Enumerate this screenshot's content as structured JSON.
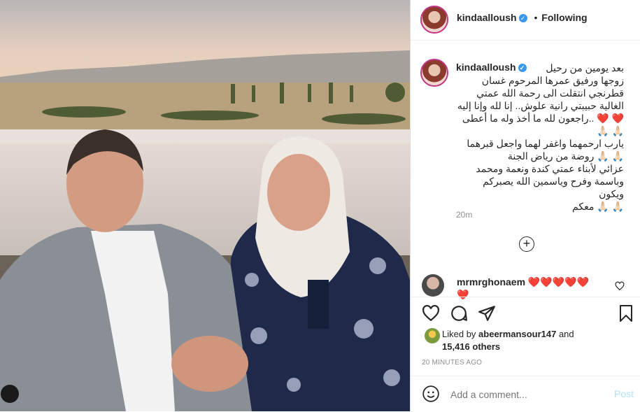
{
  "post": {
    "username": "kindaalloush",
    "follow_status": "Following",
    "separator": "•",
    "caption": "بعد يومين من رحيل\nزوجها ورفيق عمرها المرحوم غسان\nقطرنجي انتقلت الى رحمة الله عمتي\nالغالية حبيبتي رانية علوش.. إنا لله وإنا إليه\n❤️ ❤️ ..راجعون لله ما أخذ وله ما أعطى\n🙏🏻 🙏🏻\nيارب ارحمهما واغفر لهما واجعل قبرهما\n🙏🏻 🙏🏻 روضة من رياض الجنة\nعزائي لأبناء عمتي كندة ونعمة ومحمد\nوباسمة وفرح وياسمين الله يصبركم ويكون\n🙏🏻 🙏🏻 معكم",
    "caption_time": "20m"
  },
  "comment": {
    "username": "mrmrghonaem",
    "text": "❤️❤️❤️❤️❤️\n❤️"
  },
  "likes": {
    "liked_by_prefix": "Liked by",
    "liked_by_user": "abeermansour147",
    "and_text": "and",
    "others": "15,416 others"
  },
  "timestamp": "20 MINUTES AGO",
  "add_comment": {
    "placeholder": "Add a comment...",
    "post_label": "Post"
  },
  "colors": {
    "verified": "#3897f0",
    "link": "#0095f6",
    "post_disabled": "#b2dffc",
    "heart": "#ed4956"
  }
}
